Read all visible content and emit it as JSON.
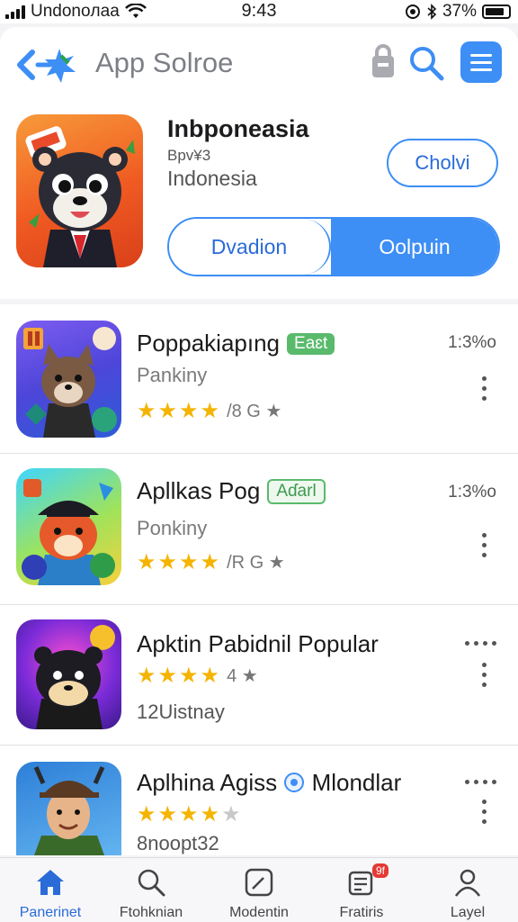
{
  "status_bar": {
    "carrier": "Undonoлaa",
    "time": "9:43",
    "battery": "37%"
  },
  "toolbar": {
    "title": "App Solroe"
  },
  "featured": {
    "name": "Inbponeasia",
    "developer": "Bpv¥3",
    "country": "Indonesia",
    "chip_label": "Cholvi",
    "segment_left": "Dvadion",
    "segment_right": "Oolpuin"
  },
  "apps": [
    {
      "name": "Poppakiapıng",
      "badge": "Eaɛt",
      "time": "1:3%o",
      "subtitle": "Pankiny",
      "rating_text": "/8 G ★"
    },
    {
      "name": "Apllkas Pog",
      "badge": "Aɗarl",
      "time": "1:3%o",
      "subtitle": "Ponkiny",
      "rating_text": "/R G ★"
    },
    {
      "name": "Apktin Pabidnil Popular",
      "rating_text": "4 ★",
      "subtitle": "12Uistnay"
    },
    {
      "name": "Aplhina Agiss",
      "name_suffix": "Mlondlar",
      "subtitle": "8noopt32"
    }
  ],
  "tabs": [
    {
      "label": "Panerinet"
    },
    {
      "label": "Ftohknian"
    },
    {
      "label": "Modentin"
    },
    {
      "label": "Fratiris",
      "badge": "9f"
    },
    {
      "label": "Layel"
    }
  ],
  "colors": {
    "accent": "#3d8ef5",
    "badge_green": "#5aba6c",
    "star": "#f4b400"
  }
}
